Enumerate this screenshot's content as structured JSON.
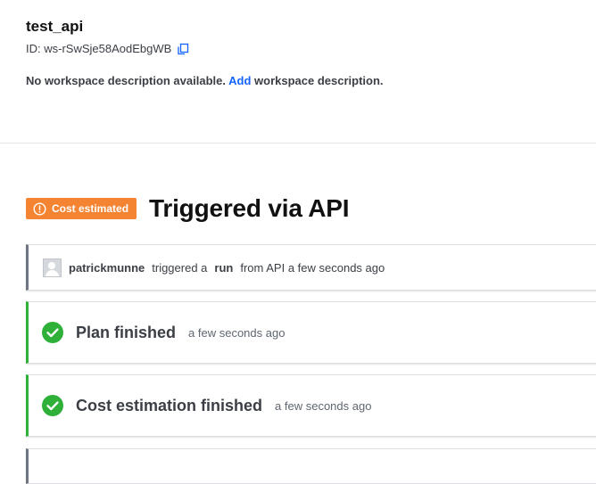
{
  "workspace": {
    "title": "test_api",
    "id_label": "ID: ws-rSwSje58AodEbgWB",
    "description_prefix": "No workspace description available.",
    "description_link": "Add",
    "description_suffix": "workspace description."
  },
  "run": {
    "badge_label": "Cost estimated",
    "title": "Triggered via API",
    "trigger": {
      "user": "patrickmunne",
      "text1": "triggered a",
      "run_word": "run",
      "text2": "from API a few seconds ago"
    },
    "steps": [
      {
        "title": "Plan finished",
        "time": "a few seconds ago"
      },
      {
        "title": "Cost estimation finished",
        "time": "a few seconds ago"
      }
    ]
  },
  "colors": {
    "badge": "#f58432",
    "success": "#2eb039",
    "link": "#1563ff"
  },
  "icons": [
    "copy-icon",
    "alert-circle-icon",
    "avatar",
    "check-circle-icon"
  ]
}
